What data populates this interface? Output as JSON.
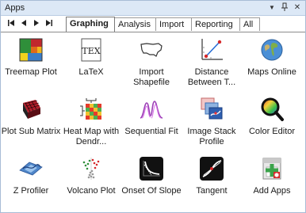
{
  "window": {
    "title": "Apps",
    "dropdown_glyph": "▼",
    "pin_glyph": "⊥",
    "close_glyph": "✕"
  },
  "nav": {
    "first": "⏮",
    "prev": "◀",
    "next": "▶",
    "last": "⏭"
  },
  "tabs": [
    {
      "label": "Graphing",
      "active": true
    },
    {
      "label": "Analysis",
      "active": false
    },
    {
      "label": "Import",
      "active": false
    },
    {
      "label": "Reporting",
      "active": false
    },
    {
      "label": "All",
      "active": false
    }
  ],
  "apps": [
    {
      "label": "Treemap Plot",
      "icon": "treemap-icon"
    },
    {
      "label": "LaTeX",
      "icon": "latex-icon"
    },
    {
      "label": "Import Shapefile",
      "icon": "usa-map-outline-icon"
    },
    {
      "label": "Distance Between T...",
      "icon": "distance-plot-icon"
    },
    {
      "label": "Maps Online",
      "icon": "globe-icon"
    },
    {
      "label": "Plot Sub Matrix",
      "icon": "matrix-3d-icon"
    },
    {
      "label": "Heat Map with Dendr...",
      "icon": "heatmap-dendrogram-icon"
    },
    {
      "label": "Sequential Fit",
      "icon": "peak-fit-icon"
    },
    {
      "label": "Image Stack Profile",
      "icon": "image-stack-icon"
    },
    {
      "label": "Color Editor",
      "icon": "color-magnifier-icon"
    },
    {
      "label": "Z Profiler",
      "icon": "z-profiler-icon"
    },
    {
      "label": "Volcano Plot",
      "icon": "volcano-scatter-icon"
    },
    {
      "label": "Onset Of Slope",
      "icon": "onset-slope-icon"
    },
    {
      "label": "Tangent",
      "icon": "tangent-curve-icon"
    },
    {
      "label": "Add Apps",
      "icon": "add-apps-icon"
    }
  ],
  "colors": {
    "titlebar": "#dce8f6",
    "border": "#a8bcd6"
  }
}
